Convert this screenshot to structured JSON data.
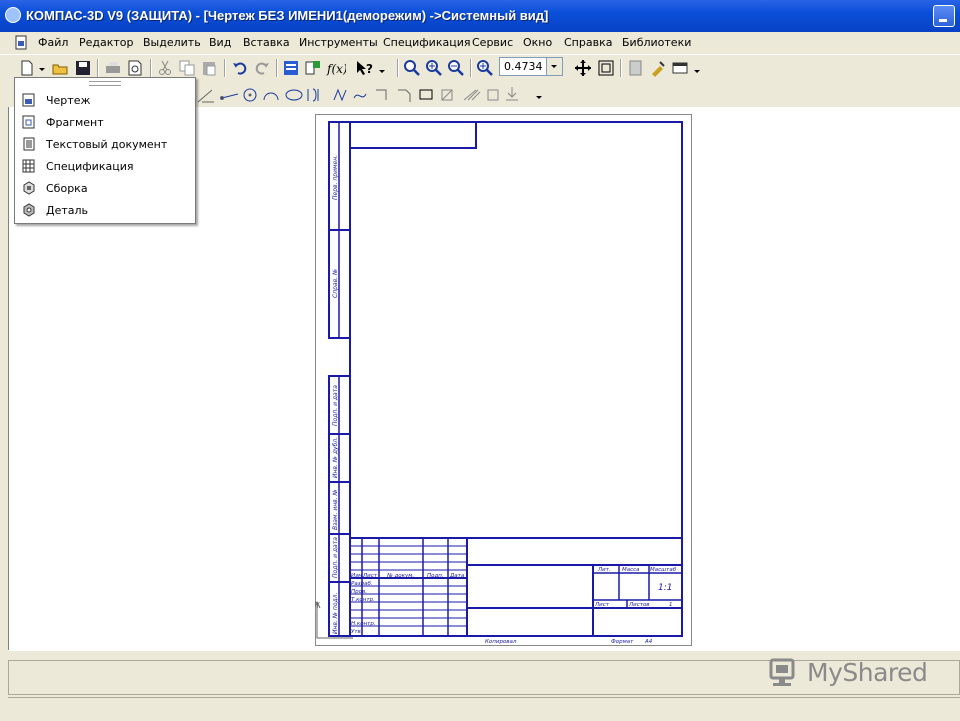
{
  "window": {
    "title": "КОМПАС-3D V9 (ЗАЩИТА) - [Чертеж БЕЗ ИМЕНИ1(деморежим) ->Системный вид]"
  },
  "menu": [
    {
      "first": "Ф",
      "rest": "айл"
    },
    {
      "first": "Р",
      "rest": "едактор"
    },
    {
      "first": "В",
      "rest": "ыделить"
    },
    {
      "first": "В",
      "rest": "ид"
    },
    {
      "first": "Вст",
      "rest": "авка",
      "underline_index": 3
    },
    {
      "first": "И",
      "rest": "нструменты"
    },
    {
      "first": "С",
      "rest": "пецификация"
    },
    {
      "first": "Се",
      "rest": "рвис"
    },
    {
      "first": "О",
      "rest": "кно"
    },
    {
      "first": "С",
      "rest": "правка"
    },
    {
      "first": "Б",
      "rest": "иблиотеки"
    }
  ],
  "menu_labels": [
    "Файл",
    "Редактор",
    "Выделить",
    "Вид",
    "Вставка",
    "Инструменты",
    "Спецификация",
    "Сервис",
    "Окно",
    "Справка",
    "Библиотеки"
  ],
  "toolbar": {
    "zoom_value": "0.4734"
  },
  "new_document_menu": {
    "items": [
      {
        "label": "Чертеж",
        "icon": "drawing-doc-icon"
      },
      {
        "label": "Фрагмент",
        "icon": "fragment-doc-icon"
      },
      {
        "label": "Текстовый документ",
        "icon": "text-doc-icon"
      },
      {
        "label": "Спецификация",
        "icon": "specification-doc-icon"
      },
      {
        "label": "Сборка",
        "icon": "assembly-doc-icon"
      },
      {
        "label": "Деталь",
        "icon": "part-doc-icon"
      }
    ]
  },
  "drawing_sheet": {
    "side_labels": [
      "Перв. примен.",
      "Справ. №",
      "Подп. и дата",
      "Инв. № дубл.",
      "Взам. инв. №",
      "Подп. и дата",
      "Инв. № подл."
    ],
    "stamp": {
      "izm": "Изм.",
      "list": "Лист",
      "ndokum": "№ докум.",
      "podp": "Подп.",
      "data": "Дата",
      "razrab": "Разраб.",
      "prov": "Пров.",
      "tkontr": "Т.контр.",
      "nkontr": "Н.контр.",
      "utv": "Утв.",
      "lit": "Лит.",
      "massa": "Масса",
      "masshtab": "Масштаб",
      "scale_value": "1:1",
      "sheet": "Лист",
      "sheets": "Листов",
      "sheets_value": "1",
      "copied": "Копировал",
      "format": "Формат",
      "format_value": "A4"
    },
    "axis_y": "Y"
  },
  "watermark": {
    "text": "MyShared"
  },
  "colors": {
    "titlebar": "#0a4fd8",
    "sheet_lines": "#1a1aa8",
    "ui_face": "#ece9d8"
  }
}
